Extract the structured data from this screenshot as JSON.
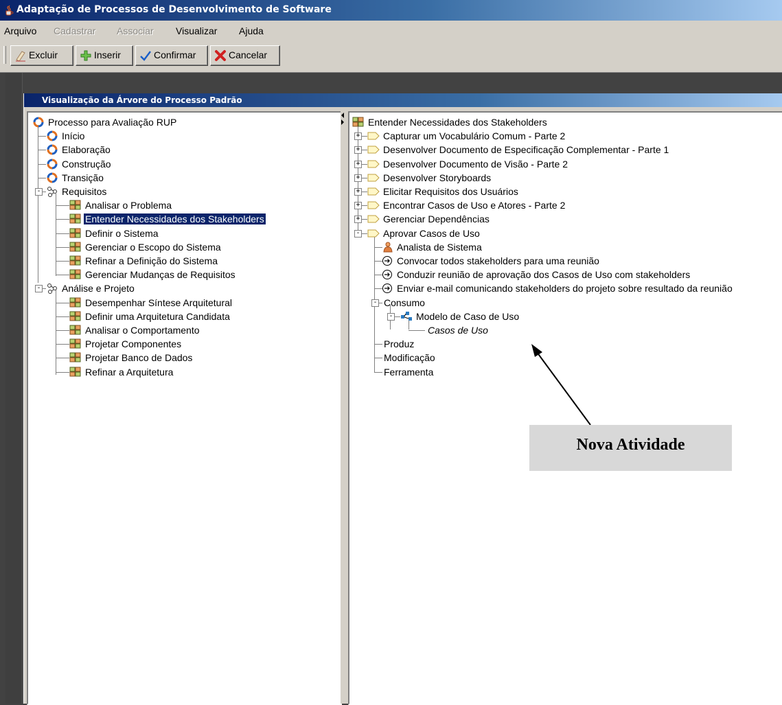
{
  "window": {
    "title": "Adaptação de Processos de Desenvolvimento de Software"
  },
  "menu": [
    {
      "label": "Arquivo",
      "enabled": true
    },
    {
      "label": "Cadastrar",
      "enabled": false
    },
    {
      "label": "Associar",
      "enabled": false
    },
    {
      "label": "Visualizar",
      "enabled": true
    },
    {
      "label": "Ajuda",
      "enabled": true
    }
  ],
  "toolbar": {
    "excluir": "Excluir",
    "inserir": "Inserir",
    "confirmar": "Confirmar",
    "cancelar": "Cancelar"
  },
  "internal_frame": {
    "title": "Visualização da Árvore do Processo Padrão"
  },
  "left_tree": [
    {
      "label": "Processo para Avaliação RUP",
      "icon": "process-cycle-icon"
    },
    {
      "label": "Início",
      "icon": "phase-cycle-icon"
    },
    {
      "label": "Elaboração",
      "icon": "phase-cycle-icon"
    },
    {
      "label": "Construção",
      "icon": "phase-cycle-icon"
    },
    {
      "label": "Transição",
      "icon": "phase-cycle-icon"
    },
    {
      "label": "Requisitos",
      "icon": "discipline-icon",
      "expanded": true
    },
    {
      "label": "Analisar o Problema",
      "icon": "activity-icon"
    },
    {
      "label": "Entender Necessidades dos Stakeholders",
      "icon": "activity-icon",
      "selected": true
    },
    {
      "label": "Definir o Sistema",
      "icon": "activity-icon"
    },
    {
      "label": "Gerenciar o Escopo do Sistema",
      "icon": "activity-icon"
    },
    {
      "label": "Refinar a Definição do Sistema",
      "icon": "activity-icon"
    },
    {
      "label": "Gerenciar Mudanças de Requisitos",
      "icon": "activity-icon"
    },
    {
      "label": "Análise e Projeto",
      "icon": "discipline-icon",
      "expanded": true
    },
    {
      "label": "Desempenhar Síntese Arquitetural",
      "icon": "activity-icon"
    },
    {
      "label": "Definir uma Arquitetura Candidata",
      "icon": "activity-icon"
    },
    {
      "label": "Analisar o Comportamento",
      "icon": "activity-icon"
    },
    {
      "label": "Projetar Componentes",
      "icon": "activity-icon"
    },
    {
      "label": "Projetar Banco de Dados",
      "icon": "activity-icon"
    },
    {
      "label": "Refinar a Arquitetura",
      "icon": "activity-icon"
    }
  ],
  "right_tree": [
    {
      "label": "Entender Necessidades dos Stakeholders",
      "icon": "activity-icon"
    },
    {
      "label": "Capturar um Vocabulário Comum - Parte 2",
      "icon": "step-tag-icon",
      "expander": "+"
    },
    {
      "label": "Desenvolver Documento de Especificação Complementar - Parte 1",
      "icon": "step-tag-icon",
      "expander": "+"
    },
    {
      "label": "Desenvolver Documento de Visão - Parte 2",
      "icon": "step-tag-icon",
      "expander": "+"
    },
    {
      "label": "Desenvolver Storyboards",
      "icon": "step-tag-icon",
      "expander": "+"
    },
    {
      "label": "Elicitar Requisitos dos Usuários",
      "icon": "step-tag-icon",
      "expander": "+"
    },
    {
      "label": "Encontrar Casos de Uso e Atores - Parte 2",
      "icon": "step-tag-icon",
      "expander": "+"
    },
    {
      "label": "Gerenciar Dependências",
      "icon": "step-tag-icon",
      "expander": "+"
    },
    {
      "label": "Aprovar Casos de Uso",
      "icon": "step-tag-icon",
      "expander": "-"
    },
    {
      "label": "Analista de Sistema",
      "icon": "role-person-icon"
    },
    {
      "label": "Convocar todos stakeholders para uma reunião",
      "icon": "circle-arrow-icon"
    },
    {
      "label": "Conduzir reunião de aprovação dos Casos de Uso com stakeholders",
      "icon": "circle-arrow-icon"
    },
    {
      "label": "Enviar e-mail comunicando stakeholders do projeto sobre resultado da reunião",
      "icon": "circle-arrow-icon"
    },
    {
      "label": "Consumo",
      "icon": "",
      "expander": "-"
    },
    {
      "label": "Modelo de Caso de Uso",
      "icon": "model-icon",
      "expander": "-"
    },
    {
      "label": "Casos de Uso",
      "icon": "",
      "italic": true
    },
    {
      "label": "Produz",
      "icon": ""
    },
    {
      "label": "Modificação",
      "icon": ""
    },
    {
      "label": "Ferramenta",
      "icon": ""
    }
  ],
  "callout": {
    "text": "Nova Atividade"
  },
  "colors": {
    "selection": "#0a246a",
    "titlebar": "#0a246a",
    "chrome": "#d4d0c8"
  }
}
